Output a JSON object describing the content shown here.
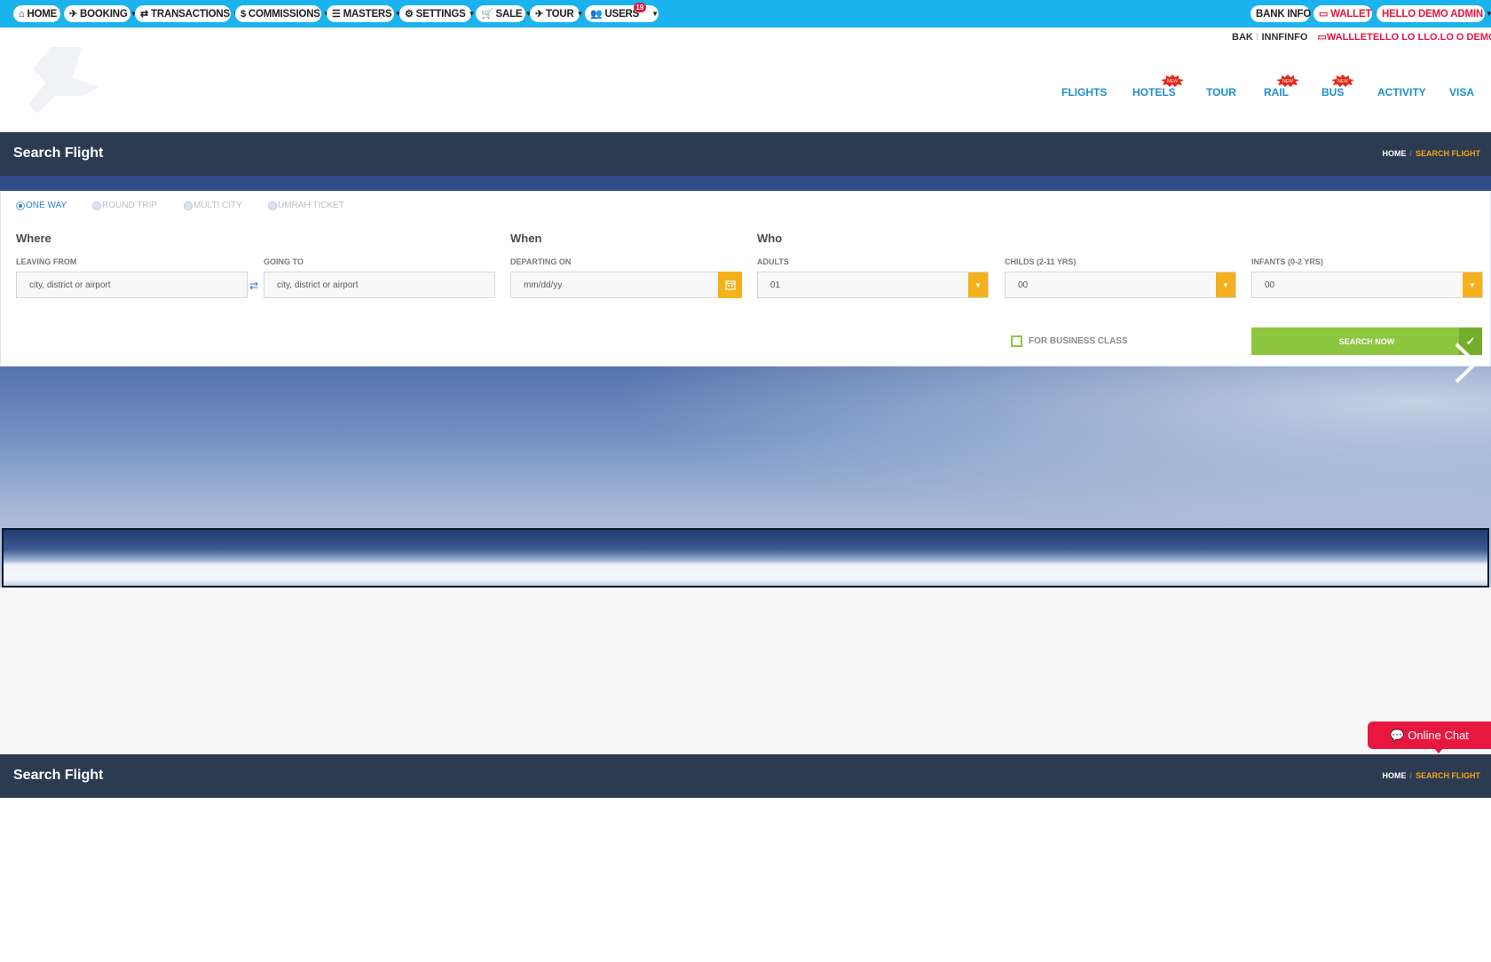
{
  "topbar": {
    "menu": [
      {
        "label": "HOME",
        "icon": "home-icon",
        "caret": false
      },
      {
        "label": "BOOKING",
        "icon": "plane-icon",
        "caret": true
      },
      {
        "label": "TRANSACTIONS",
        "icon": "exchange-icon",
        "caret": true
      },
      {
        "label": "COMMISSIONS",
        "icon": "dollar-icon",
        "caret": true
      },
      {
        "label": "MASTERS",
        "icon": "list-icon",
        "caret": true
      },
      {
        "label": "SETTINGS",
        "icon": "gears-icon",
        "caret": true
      },
      {
        "label": "SALE",
        "icon": "cart-icon",
        "caret": true
      },
      {
        "label": "TOUR",
        "icon": "plane-icon",
        "caret": true
      },
      {
        "label": "USERS",
        "icon": "users-icon",
        "caret": true,
        "badge": "19"
      }
    ],
    "bank_info": "BANK INFO",
    "wallet": "WALLET",
    "user": "HELLO  DEMO ADMIN"
  },
  "ghost_row": {
    "bank": "BAK",
    "info": "INNFINFO",
    "wallet": "WALLLETELLO  LO  LLO.LO  O  DEMO AIN"
  },
  "product_nav": [
    "FLIGHTS",
    "HOTELS",
    "TOUR",
    "RAIL",
    "BUS",
    "ACTIVITY",
    "VISA"
  ],
  "new_badge": "NEW",
  "page": {
    "title": "Search Flight",
    "breadcrumb_home": "HOME",
    "breadcrumb_current": "SEARCH FLIGHT"
  },
  "search": {
    "trip_types": [
      "ONE WAY",
      "ROUND TRIP",
      "MULTI CITY",
      "UMRAH TICKET"
    ],
    "selected_trip": "ONE WAY",
    "where_heading": "Where",
    "when_heading": "When",
    "who_heading": "Who",
    "leaving_label": "LEAVING FROM",
    "leaving_placeholder": "city, district or airport",
    "going_label": "GOING TO",
    "going_placeholder": "city, district or airport",
    "departing_label": "DEPARTING ON",
    "departing_placeholder": "mm/dd/yy",
    "adults_label": "ADULTS",
    "adults_value": "01",
    "childs_label": "CHILDS (2-11 YRS)",
    "childs_value": "00",
    "infants_label": "INFANTS (0-2 YRS)",
    "infants_value": "00",
    "business_class_label": "FOR BUSINESS CLASS",
    "search_button": "SEARCH NOW"
  },
  "chat": {
    "label": "Online Chat"
  },
  "footer_bar": {
    "title": "Search Flight",
    "breadcrumb_home": "HOME",
    "breadcrumb_current": "SEARCH FLIGHT"
  },
  "colors": {
    "topbar": "#1ab3ee",
    "nav_link": "#1f8fcf",
    "titlebar": "#2c3b51",
    "accent_orange": "#f5b11d",
    "accent_green": "#8dc63f",
    "chat_red": "#e8173f"
  }
}
